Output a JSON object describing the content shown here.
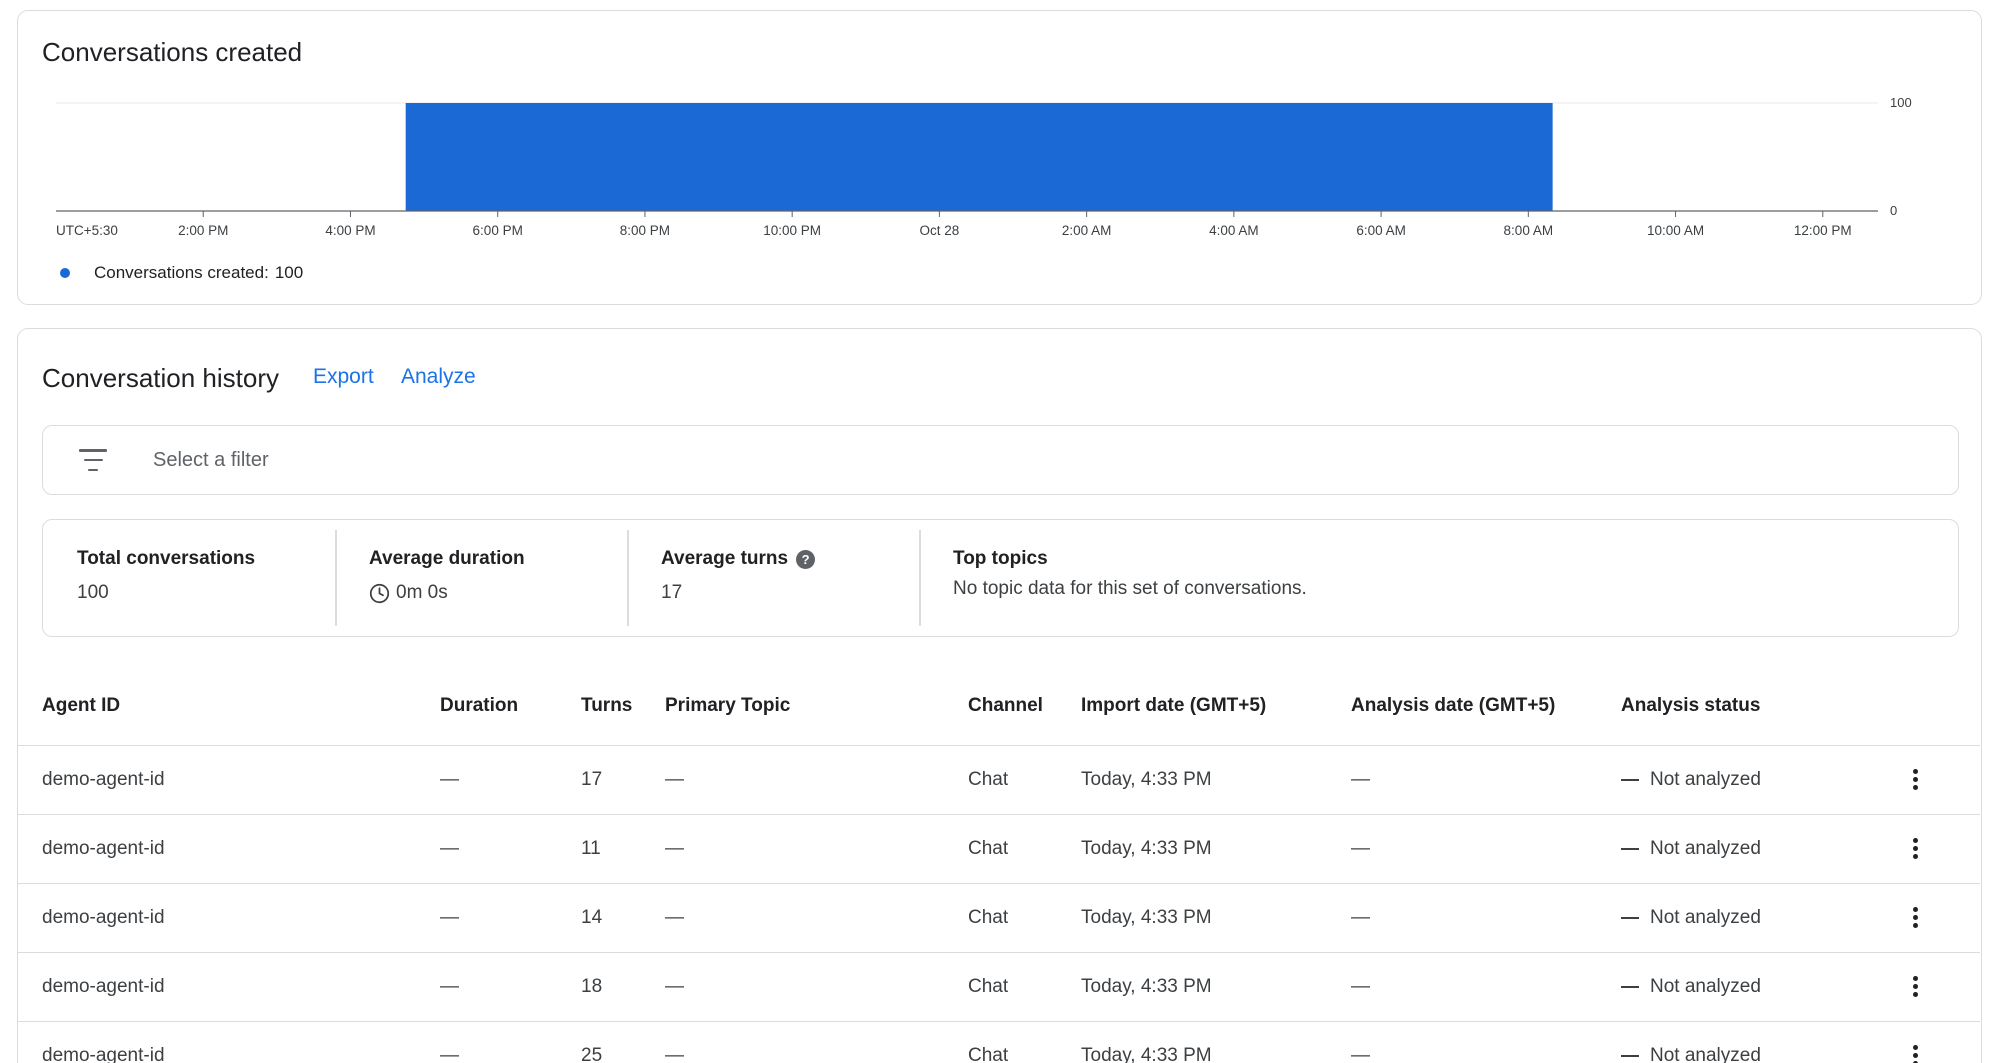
{
  "chart_card": {
    "title": "Conversations created"
  },
  "chart_data": {
    "type": "area",
    "title": "Conversations created",
    "xlabel": "",
    "ylabel": "",
    "x_tick_labels": [
      "UTC+5:30",
      "2:00 PM",
      "4:00 PM",
      "6:00 PM",
      "8:00 PM",
      "10:00 PM",
      "Oct 28",
      "2:00 AM",
      "4:00 AM",
      "6:00 AM",
      "8:00 AM",
      "10:00 AM",
      "12:00 PM"
    ],
    "y_tick_labels": [
      "0",
      "100"
    ],
    "ylim": [
      0,
      100
    ],
    "x_hours_from_midnight": [
      12.5,
      14,
      16,
      18,
      20,
      22,
      24,
      26,
      28,
      30,
      32,
      34,
      36
    ],
    "series": [
      {
        "name": "Conversations created",
        "x_start": "4:45 PM",
        "x_end": "8:20 AM",
        "x_start_hours": 16.75,
        "x_end_hours": 32.33,
        "value": 100
      }
    ],
    "grid": true,
    "legend_position": "bottom-left",
    "color": "#1a69d4"
  },
  "legend": {
    "label": "Conversations created:",
    "value": "100"
  },
  "history": {
    "title": "Conversation history",
    "export_label": "Export",
    "analyze_label": "Analyze",
    "filter_placeholder": "Select a filter"
  },
  "stats": {
    "total_label": "Total conversations",
    "total_value": "100",
    "duration_label": "Average duration",
    "duration_value": "0m 0s",
    "turns_label": "Average turns",
    "turns_value": "17",
    "topics_label": "Top topics",
    "topics_value": "No topic data for this set of conversations."
  },
  "table": {
    "columns": [
      "Agent ID",
      "Duration",
      "Turns",
      "Primary Topic",
      "Channel",
      "Import date (GMT+5)",
      "Analysis date (GMT+5)",
      "Analysis status"
    ],
    "rows": [
      [
        "demo-agent-id",
        "—",
        "17",
        "—",
        "Chat",
        "Today, 4:33 PM",
        "—",
        "Not analyzed"
      ],
      [
        "demo-agent-id",
        "—",
        "11",
        "—",
        "Chat",
        "Today, 4:33 PM",
        "—",
        "Not analyzed"
      ],
      [
        "demo-agent-id",
        "—",
        "14",
        "—",
        "Chat",
        "Today, 4:33 PM",
        "—",
        "Not analyzed"
      ],
      [
        "demo-agent-id",
        "—",
        "18",
        "—",
        "Chat",
        "Today, 4:33 PM",
        "—",
        "Not analyzed"
      ],
      [
        "demo-agent-id",
        "—",
        "25",
        "—",
        "Chat",
        "Today, 4:33 PM",
        "—",
        "Not analyzed"
      ]
    ]
  }
}
